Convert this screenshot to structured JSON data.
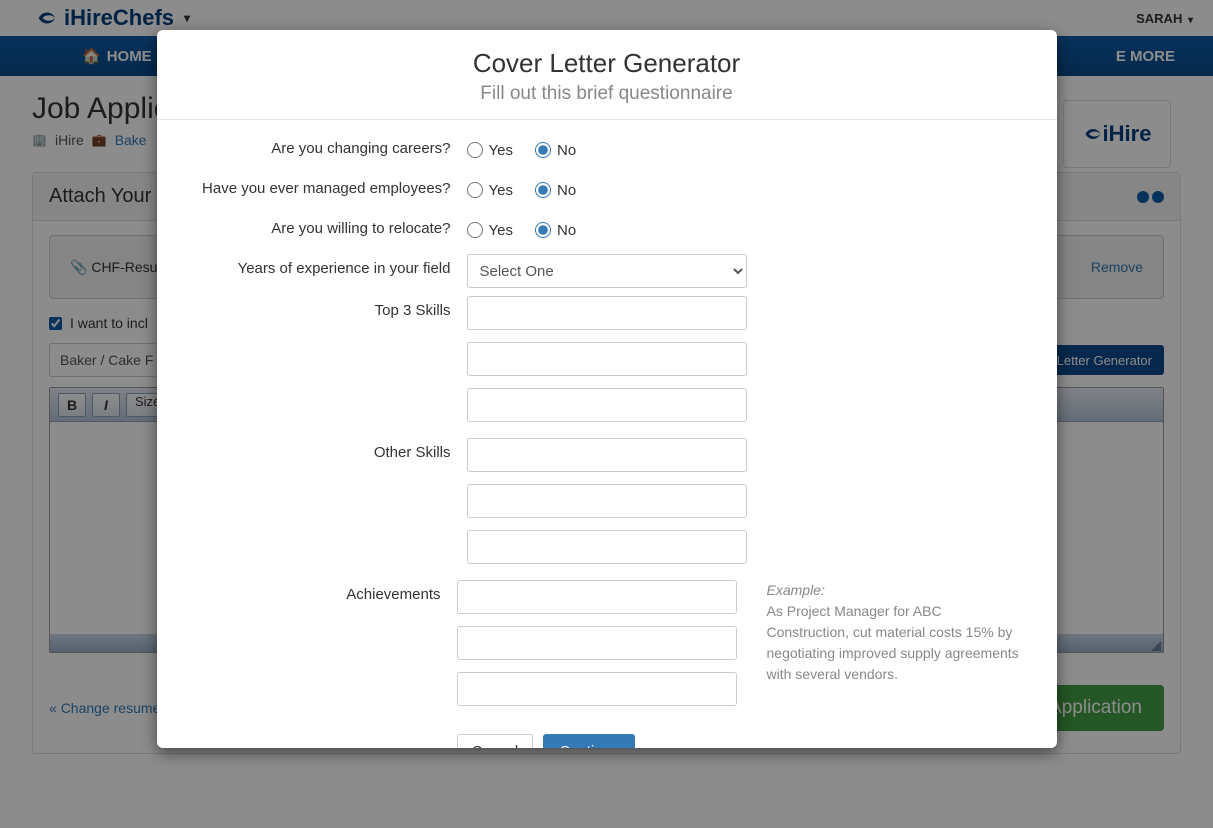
{
  "brand": {
    "name": "iHireChefs"
  },
  "user": {
    "name": "SARAH"
  },
  "nav": {
    "home": "HOME",
    "more": "E MORE"
  },
  "page": {
    "title": "Job Applic",
    "crumb_company": "iHire",
    "crumb_job": "Bake"
  },
  "side_logo": {
    "text": "iHire"
  },
  "panel": {
    "heading": "Attach Your R",
    "file_name": "CHF-Resu",
    "remove": "Remove",
    "include_label": "I want to incl",
    "select_value": "Baker / Cake F",
    "generator_btn": "Letter Generator",
    "size_label": "Size",
    "change_resume": "Change resume",
    "submit": "Submit Application"
  },
  "modal": {
    "title": "Cover Letter Generator",
    "subtitle": "Fill out this brief questionnaire",
    "questions": {
      "changing_careers": "Are you changing careers?",
      "managed_employees": "Have you ever managed employees?",
      "relocate": "Are you willing to relocate?",
      "years_experience": "Years of experience in your field",
      "top3_skills": "Top 3 Skills",
      "other_skills": "Other Skills",
      "achievements": "Achievements"
    },
    "yes": "Yes",
    "no": "No",
    "select_one": "Select One",
    "example_label": "Example:",
    "example_text": "As Project Manager for ABC Construction, cut material costs 15% by negotiating improved supply agreements with several vendors.",
    "cancel": "Cancel",
    "continue": "Continue"
  }
}
